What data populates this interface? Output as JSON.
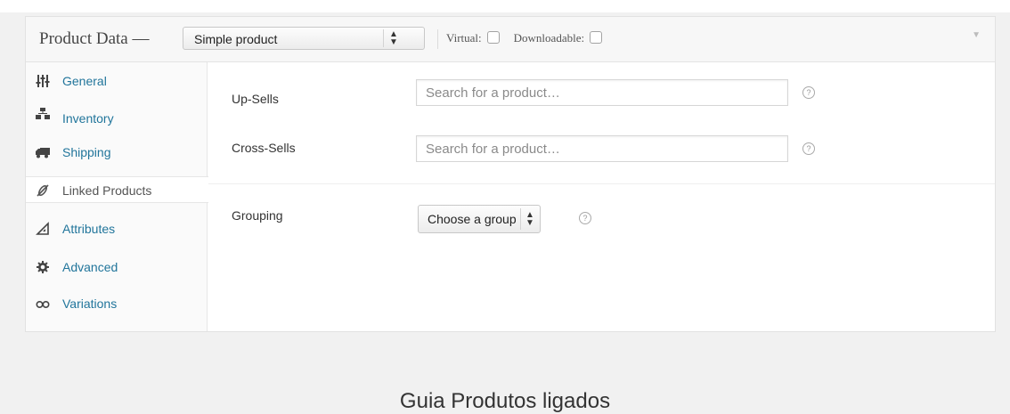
{
  "panel": {
    "title": "Product Data —",
    "product_type": "Simple product",
    "virtual_label": "Virtual:",
    "downloadable_label": "Downloadable:",
    "collapse_glyph": "▼"
  },
  "tabs": [
    {
      "label": "General",
      "icon": "sliders-icon",
      "active": false
    },
    {
      "label": "Inventory",
      "icon": "inventory-icon",
      "active": false
    },
    {
      "label": "Shipping",
      "icon": "truck-icon",
      "active": false
    },
    {
      "label": "Linked Products",
      "icon": "link-icon",
      "active": true
    },
    {
      "label": "Attributes",
      "icon": "triangle-ruler-icon",
      "active": false
    },
    {
      "label": "Advanced",
      "icon": "gear-icon",
      "active": false
    },
    {
      "label": "Variations",
      "icon": "infinity-icon",
      "active": false
    }
  ],
  "fields": {
    "upsells": {
      "label": "Up-Sells",
      "placeholder": "Search for a product…"
    },
    "crosssells": {
      "label": "Cross-Sells",
      "placeholder": "Search for a product…"
    },
    "grouping": {
      "label": "Grouping",
      "value": "Choose a group"
    }
  },
  "help_glyph": "?",
  "caption": "Guia Produtos ligados",
  "colors": {
    "link": "#21759b",
    "active_text": "#555555",
    "icon": "#444444"
  }
}
